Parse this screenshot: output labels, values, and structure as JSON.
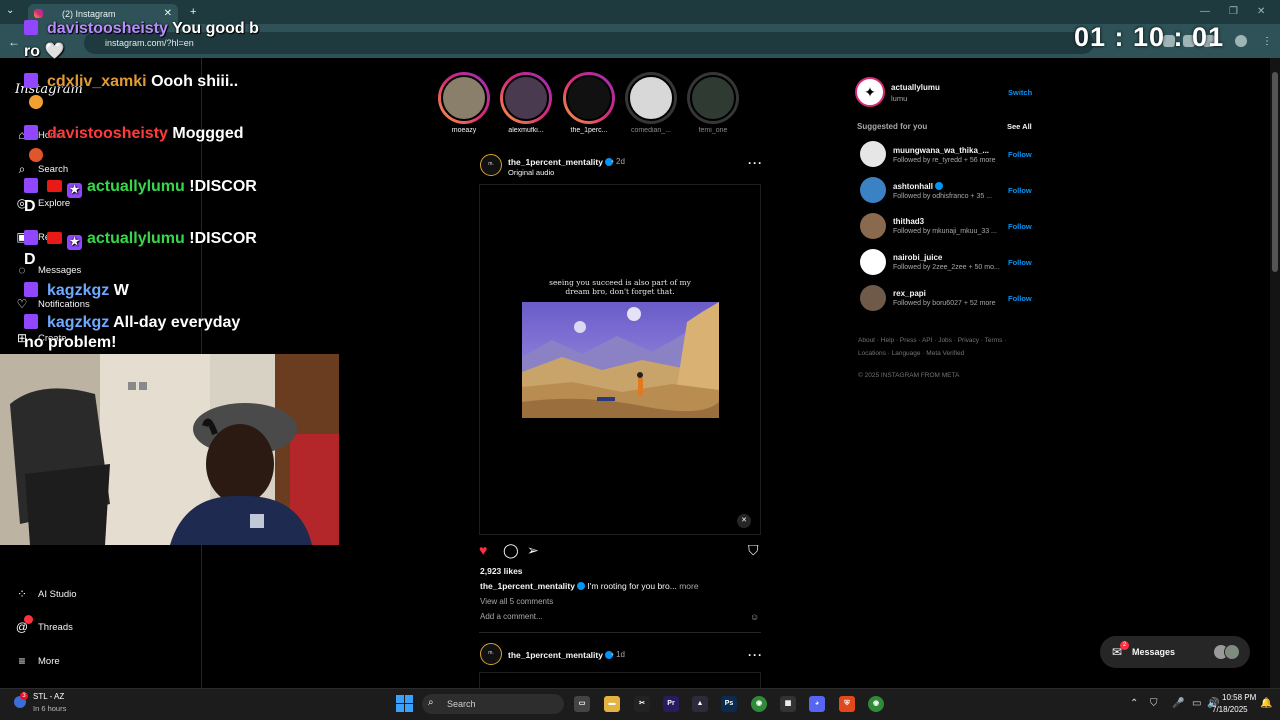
{
  "browser": {
    "tab_title": "(2) Instagram",
    "new_tab": "+",
    "url": "instagram.com/?hl=en"
  },
  "stream": {
    "timer": "01 : 10 : 01",
    "chat": [
      {
        "user": "davistoosheisty",
        "text": "You good b",
        "cont": "ro 🤍"
      },
      {
        "user": "cdxliv_xamki",
        "text": "Oooh shiii.."
      },
      {
        "user": "davistoosheisty",
        "text": "Moggged"
      },
      {
        "user": "actuallylumu",
        "text": "!DISCOR",
        "cont": "D"
      },
      {
        "user": "actuallylumu",
        "text": "!DISCOR",
        "cont": "D"
      },
      {
        "user": "kagzkgz",
        "text": "W"
      },
      {
        "user": "kagzkgz",
        "text": "All-day everyday",
        "cont": "no problem!"
      }
    ]
  },
  "sidebar": {
    "logo": "Instagram",
    "items": [
      {
        "label": "Home",
        "icon": "home-icon"
      },
      {
        "label": "Search",
        "icon": "search-icon"
      },
      {
        "label": "Explore",
        "icon": "compass-icon"
      },
      {
        "label": "Reels",
        "icon": "reels-icon"
      },
      {
        "label": "Messages",
        "icon": "messenger-icon"
      },
      {
        "label": "Notifications",
        "icon": "heart-icon"
      },
      {
        "label": "Create",
        "icon": "plus-square-icon"
      }
    ],
    "bottom": [
      {
        "label": "AI Studio",
        "icon": "ai-studio-icon"
      },
      {
        "label": "Threads",
        "icon": "threads-icon"
      },
      {
        "label": "More",
        "icon": "menu-icon"
      }
    ]
  },
  "stories": [
    {
      "name": "moeazy",
      "seen": false,
      "color": "#8a7f6a"
    },
    {
      "name": "alexmufki...",
      "seen": false,
      "color": "#4a3a4f"
    },
    {
      "name": "the_1perc...",
      "seen": false,
      "color": "#111111"
    },
    {
      "name": "comedian_...",
      "seen": true,
      "color": "#d8d8d8"
    },
    {
      "name": "femi_one",
      "seen": true,
      "color": "#2f3a33"
    }
  ],
  "post": {
    "username": "the_1percent_mentality",
    "age": "• 2d",
    "audio": "Original audio",
    "avatar_text": "m.",
    "quote": "seeing you succeed is also part of my dream bro, don't forget that.",
    "likes": "2,923 likes",
    "caption_user": "the_1percent_mentality",
    "caption": "I'm rooting for you bro...",
    "caption_more": "more",
    "view_all": "View all 5 comments",
    "add_comment": "Add a comment...",
    "accent": "#ff3040"
  },
  "post2": {
    "username": "the_1percent_mentality",
    "age": "• 1d",
    "avatar_text": "m."
  },
  "right": {
    "me": {
      "username": "actuallylumu",
      "name": "lumu",
      "switch": "Switch"
    },
    "suggested_title": "Suggested for you",
    "see_all": "See All",
    "suggestions": [
      {
        "username": "muungwana_wa_thika_...",
        "sub": "Followed by re_tyredd + 56 more",
        "follow": "Follow",
        "color": "#e6e6e6",
        "verified": false
      },
      {
        "username": "ashtonhall",
        "sub": "Followed by odhisfranco + 35 ...",
        "follow": "Follow",
        "color": "#3b82c4",
        "verified": true
      },
      {
        "username": "thithad3",
        "sub": "Followed by mkunaji_mkuu_33 ...",
        "follow": "Follow",
        "color": "#8a6a4f",
        "verified": false
      },
      {
        "username": "nairobi_juice",
        "sub": "Followed by 2zee_2zee + 50 mo...",
        "follow": "Follow",
        "color": "#ffffff",
        "verified": false
      },
      {
        "username": "rex_papi",
        "sub": "Followed by boru6027 + 52 more",
        "follow": "Follow",
        "color": "#6f5a4a",
        "verified": false
      }
    ],
    "footer1": "About · Help · Press · API · Jobs · Privacy · Terms ·",
    "footer2": "Locations · Language · Meta Verified",
    "copyright": "© 2025 INSTAGRAM FROM META"
  },
  "messages_pill": {
    "label": "Messages",
    "badge": "2"
  },
  "taskbar": {
    "weather_title": "STL - AZ",
    "weather_sub": "In 6 hours",
    "weather_badge": "3",
    "search": "Search",
    "time": "10:58 PM",
    "date": "7/18/2025"
  }
}
